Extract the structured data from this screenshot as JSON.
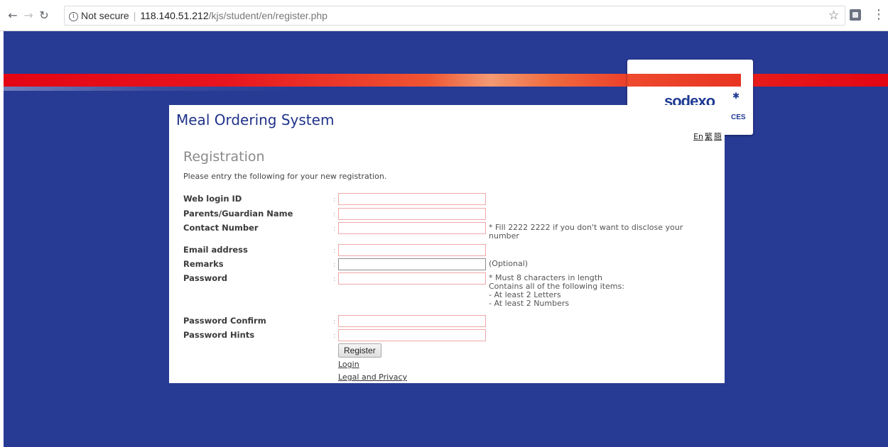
{
  "browser": {
    "security_label": "Not secure",
    "url_host": "118.140.51.212",
    "url_path": "/kjs/student/en/register.php"
  },
  "logo": {
    "word": "sodexo",
    "subtitle": "CES"
  },
  "page": {
    "site_title": "Meal Ordering System",
    "languages": [
      "En",
      "繁",
      "簡"
    ],
    "section_title": "Registration",
    "intro": "Please entry the following for your new registration.",
    "fields": [
      {
        "label": "Web login ID",
        "value": "",
        "note": ""
      },
      {
        "label": "Parents/Guardian Name",
        "value": "",
        "note": ""
      },
      {
        "label": "Contact Number",
        "value": "",
        "note": "* Fill 2222 2222 if you don't want to disclose your number"
      },
      {
        "label": "Email address",
        "value": "",
        "note": ""
      },
      {
        "label": "Remarks",
        "value": "",
        "note": "(Optional)"
      },
      {
        "label": "Password",
        "value": "",
        "note": "* Must 8 characters in length\nContains all of the following items:\n- At least 2 Letters\n- At least 2 Numbers"
      },
      {
        "label": "Password Confirm",
        "value": "",
        "note": ""
      },
      {
        "label": "Password Hints",
        "value": "",
        "note": ""
      }
    ],
    "colon": ":",
    "register_button": "Register",
    "login_link": "Login",
    "legal_link": "Legal and Privacy"
  }
}
